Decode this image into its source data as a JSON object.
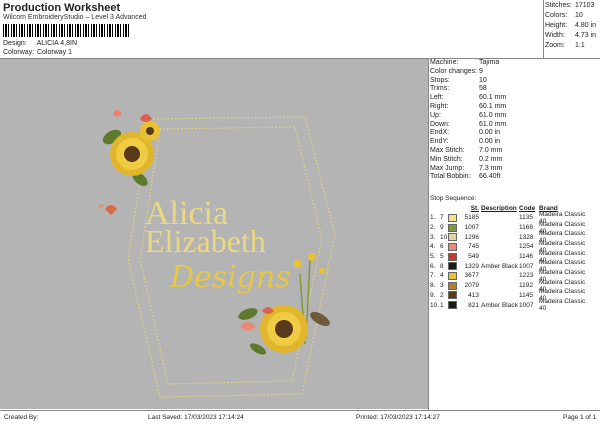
{
  "header": {
    "title": "Production Worksheet",
    "subtitle": "Wilcom EmbroideryStudio – Level 3 Advanced",
    "design_label": "Design:",
    "design_value": "ALICIA 4,8IN",
    "colorway_label": "Colorway:",
    "colorway_value": "Colorway 1"
  },
  "stats": [
    {
      "label": "Stitches:",
      "value": "17103"
    },
    {
      "label": "Colors:",
      "value": "10"
    },
    {
      "label": "Height:",
      "value": "4.80 in"
    },
    {
      "label": "Width:",
      "value": "4.73 in"
    },
    {
      "label": "Zoom:",
      "value": "1:1"
    }
  ],
  "design": {
    "line1": "Alicia",
    "line2": "Elizabeth",
    "line3": "Designs"
  },
  "info": [
    {
      "label": "Machine:",
      "value": "Tajima"
    },
    {
      "label": "Color changes:",
      "value": "9"
    },
    {
      "label": "Stops:",
      "value": "10"
    },
    {
      "label": "Trims:",
      "value": "58"
    },
    {
      "label": "Left:",
      "value": "60.1 mm"
    },
    {
      "label": "Right:",
      "value": "60.1 mm"
    },
    {
      "label": "Up:",
      "value": "61.0 mm"
    },
    {
      "label": "Down:",
      "value": "61.0 mm"
    },
    {
      "label": "EndX:",
      "value": "0.00 in"
    },
    {
      "label": "EndY:",
      "value": "0.00 in"
    },
    {
      "label": "Max Stitch:",
      "value": "7.0 mm"
    },
    {
      "label": "Min Stitch:",
      "value": "0.2 mm"
    },
    {
      "label": "Max Jump:",
      "value": "7.3 mm"
    },
    {
      "label": "Total Bobbin:",
      "value": "66.40ft"
    }
  ],
  "sequence": {
    "title": "Stop Sequence:",
    "headers": {
      "stitches": "St.",
      "description": "Description",
      "code": "Code",
      "brand": "Brand"
    },
    "rows": [
      {
        "stop": "1.",
        "n": "7",
        "color": "#f2e08a",
        "st": "5185",
        "desc": "",
        "code": "1135",
        "brand": "Madeira Classic 40"
      },
      {
        "stop": "2.",
        "n": "9",
        "color": "#7e9a3a",
        "st": "1007",
        "desc": "",
        "code": "1168",
        "brand": "Madeira Classic 40"
      },
      {
        "stop": "3.",
        "n": "10",
        "color": "#e3cfa8",
        "st": "1296",
        "desc": "",
        "code": "1328",
        "brand": "Madeira Classic 40"
      },
      {
        "stop": "4.",
        "n": "6",
        "color": "#e88a7a",
        "st": "745",
        "desc": "",
        "code": "1254",
        "brand": "Madeira Classic 40"
      },
      {
        "stop": "5.",
        "n": "5",
        "color": "#c8382e",
        "st": "549",
        "desc": "",
        "code": "1146",
        "brand": "Madeira Classic 40"
      },
      {
        "stop": "6.",
        "n": "8",
        "color": "#1c1a16",
        "st": "1329",
        "desc": "Amber Black",
        "code": "1007",
        "brand": "Madeira Classic 40"
      },
      {
        "stop": "7.",
        "n": "4",
        "color": "#e8c233",
        "st": "3677",
        "desc": "",
        "code": "1223",
        "brand": "Madeira Classic 40"
      },
      {
        "stop": "8.",
        "n": "3",
        "color": "#b77d2a",
        "st": "2079",
        "desc": "",
        "code": "1192",
        "brand": "Madeira Classic 40"
      },
      {
        "stop": "9.",
        "n": "2",
        "color": "#5c3a1e",
        "st": "413",
        "desc": "",
        "code": "1145",
        "brand": "Madeira Classic 40"
      },
      {
        "stop": "10.",
        "n": "1",
        "color": "#1c1a16",
        "st": "821",
        "desc": "Amber Black",
        "code": "1007",
        "brand": "Madeira Classic 40"
      }
    ]
  },
  "footer": {
    "created_by": "Created By:",
    "last_saved": "Last Saved: 17/03/2023 17:14:24",
    "printed": "Printed: 17/03/2023 17:14:27",
    "page": "Page 1 of 1"
  }
}
